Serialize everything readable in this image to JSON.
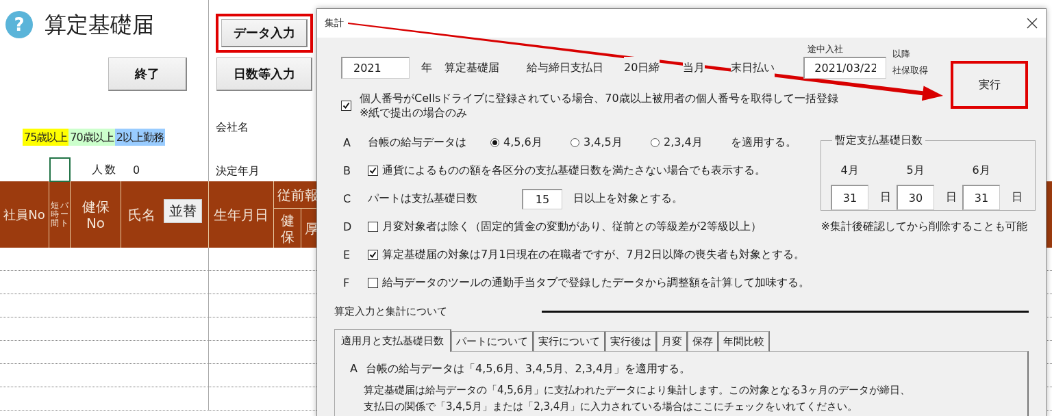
{
  "sheet": {
    "help_mark": "?",
    "title": "算定基礎届",
    "exit_button": "終了",
    "action_buttons": [
      {
        "label": "データ入力",
        "highlighted": true
      },
      {
        "label": "日数等入力",
        "highlighted": false
      }
    ],
    "legend": [
      {
        "label": "75歳以上",
        "color": "#ffff00"
      },
      {
        "label": "70歳以上",
        "color": "#ccffcc"
      },
      {
        "label": "2以上勤務",
        "color": "#99ccff"
      }
    ],
    "count_label": "人数",
    "count_value": "0",
    "company_label": "会社名",
    "decision_label": "決定年月",
    "columns": [
      {
        "kind": "plain",
        "lines": [
          "社員No"
        ]
      },
      {
        "kind": "vertical",
        "lines": [
          "短時間",
          "パート"
        ]
      },
      {
        "kind": "plain",
        "lines": [
          "健保",
          "No"
        ]
      },
      {
        "kind": "sort",
        "lines": [
          "氏名"
        ],
        "button": "並替"
      },
      {
        "kind": "plain",
        "lines": [
          "生年月日"
        ]
      },
      {
        "kind": "group",
        "lines": [
          "従前報"
        ],
        "children": [
          "健保",
          "厚"
        ]
      }
    ]
  },
  "dialog": {
    "title": "集計",
    "year_value": "2021",
    "header_texts": [
      "年",
      "算定基礎届",
      "給与締日支払日",
      "20日締",
      "当月",
      "末日払い"
    ],
    "mid_join": {
      "label": "途中入社",
      "value": "2021/03/22",
      "suffix": [
        "以降",
        "社保取得"
      ]
    },
    "run_button": {
      "label": "実行",
      "highlighted": true
    },
    "mynumber_option": {
      "checked": true,
      "lines": [
        "個人番号がCellsドライブに登録されている場合、70歳以上被用者の個人番号を取得して一括登録",
        "※紙で提出の場合のみ"
      ]
    },
    "options": [
      {
        "letter": "A",
        "kind": "radio",
        "label": "台帳の給与データは",
        "choices": [
          {
            "label": "4,5,6月",
            "selected": true
          },
          {
            "label": "3,4,5月",
            "selected": false
          },
          {
            "label": "2,3,4月",
            "selected": false
          }
        ],
        "suffix": "を適用する。"
      },
      {
        "letter": "B",
        "kind": "checkbox",
        "checked": true,
        "label": "通貨によるものの額を各区分の支払基礎日数を満たさない場合でも表示する。"
      },
      {
        "letter": "C",
        "kind": "number",
        "label": "パートは支払基礎日数",
        "value": "15",
        "suffix": "日以上を対象とする。"
      },
      {
        "letter": "D",
        "kind": "checkbox",
        "checked": false,
        "label": "月変対象者は除く（固定的賃金の変動があり、従前との等級差が2等級以上）",
        "note": "※集計後確認してから削除することも可能"
      },
      {
        "letter": "E",
        "kind": "checkbox",
        "checked": true,
        "label": "算定基礎届の対象は7月1日現在の在職者ですが、7月2日以降の喪失者も対象とする。"
      },
      {
        "letter": "F",
        "kind": "checkbox",
        "checked": false,
        "label": "給与データのツールの通勤手当タブで登録したデータから調整額を計算して加味する。"
      }
    ],
    "provisional_days": {
      "title": "暫定支払基礎日数",
      "months": [
        {
          "label": "4月",
          "value": "31",
          "unit": "日"
        },
        {
          "label": "5月",
          "value": "30",
          "unit": "日"
        },
        {
          "label": "6月",
          "value": "31",
          "unit": "日"
        }
      ]
    },
    "about": {
      "title": "算定入力と集計について",
      "tabs": [
        {
          "label": "適用月と支払基礎日数",
          "selected": true
        },
        {
          "label": "パートについて",
          "selected": false
        },
        {
          "label": "実行について",
          "selected": false
        },
        {
          "label": "実行後は",
          "selected": false
        },
        {
          "label": "月変",
          "selected": false
        },
        {
          "label": "保存",
          "selected": false
        },
        {
          "label": "年間比較",
          "selected": false
        }
      ],
      "heading_letter": "A",
      "heading": "台帳の給与データは「4,5,6月、3,4,5月、2,3,4月」を適用する。",
      "paragraph": [
        "算定基礎届は給与データの「4,5,6月」に支払われたデータにより集計します。この対象となる3ヶ月のデータが締日、",
        "支払日の関係で「3,4,5月」または「2,3,4月」に入力されている場合はここにチェックをいれてください。"
      ]
    }
  }
}
